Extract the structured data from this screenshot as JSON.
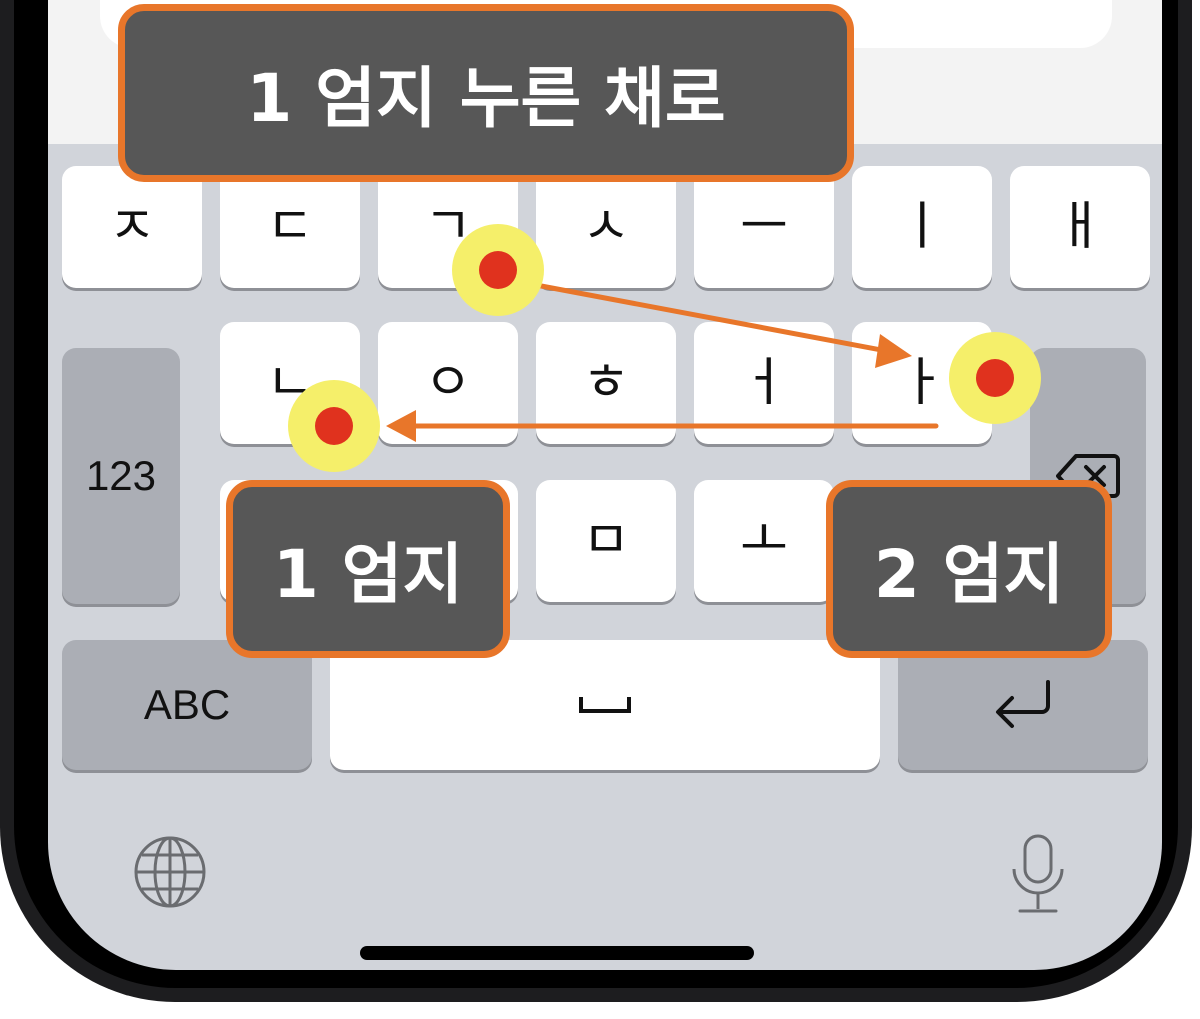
{
  "keyboard": {
    "row1": [
      "ㅈ",
      "ㄷ",
      "ㄱ",
      "ㅅ",
      "ㅡ",
      "ㅣ",
      "ㅐ"
    ],
    "row2": [
      "ㄴ",
      "ㅇ",
      "ㅎ",
      "ㅓ",
      "ㅏ"
    ],
    "row3": [
      "ㅁ",
      "ㅗ"
    ],
    "numbers_key": "123",
    "abc_key": "ABC",
    "space_key": "␣"
  },
  "annotations": {
    "top_label": "1 엄지 누른 채로",
    "left_label": "1 엄지",
    "right_label": "2 엄지"
  },
  "colors": {
    "accent_orange": "#e8762a",
    "label_bg": "#575757",
    "touch_dot": "#e0321e",
    "touch_halo": "#f5ef6a",
    "keyboard_bg": "#d1d4da"
  }
}
